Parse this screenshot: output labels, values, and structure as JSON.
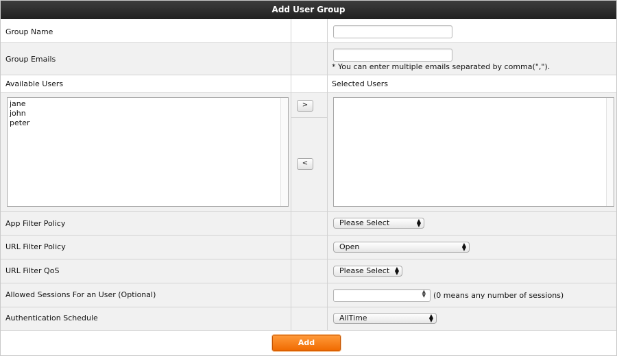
{
  "header": {
    "title": "Add User Group"
  },
  "fields": {
    "group_name": {
      "label": "Group Name",
      "value": ""
    },
    "group_emails": {
      "label": "Group Emails",
      "value": "",
      "note": "* You can enter multiple emails separated by comma(\",\")."
    },
    "available_users": {
      "label": "Available Users",
      "items": [
        "jane",
        "john",
        "peter"
      ]
    },
    "selected_users": {
      "label": "Selected Users",
      "items": []
    },
    "move_right_label": ">",
    "move_left_label": "<",
    "app_filter_policy": {
      "label": "App Filter Policy",
      "value": "Please Select"
    },
    "url_filter_policy": {
      "label": "URL Filter Policy",
      "value": "Open"
    },
    "url_filter_qos": {
      "label": "URL Filter QoS",
      "value": "Please Select"
    },
    "allowed_sessions": {
      "label": "Allowed Sessions For an User (Optional)",
      "value": "",
      "note": "(0 means any number of sessions)"
    },
    "auth_schedule": {
      "label": "Authentication Schedule",
      "value": "AllTime"
    }
  },
  "actions": {
    "add_label": "Add"
  }
}
